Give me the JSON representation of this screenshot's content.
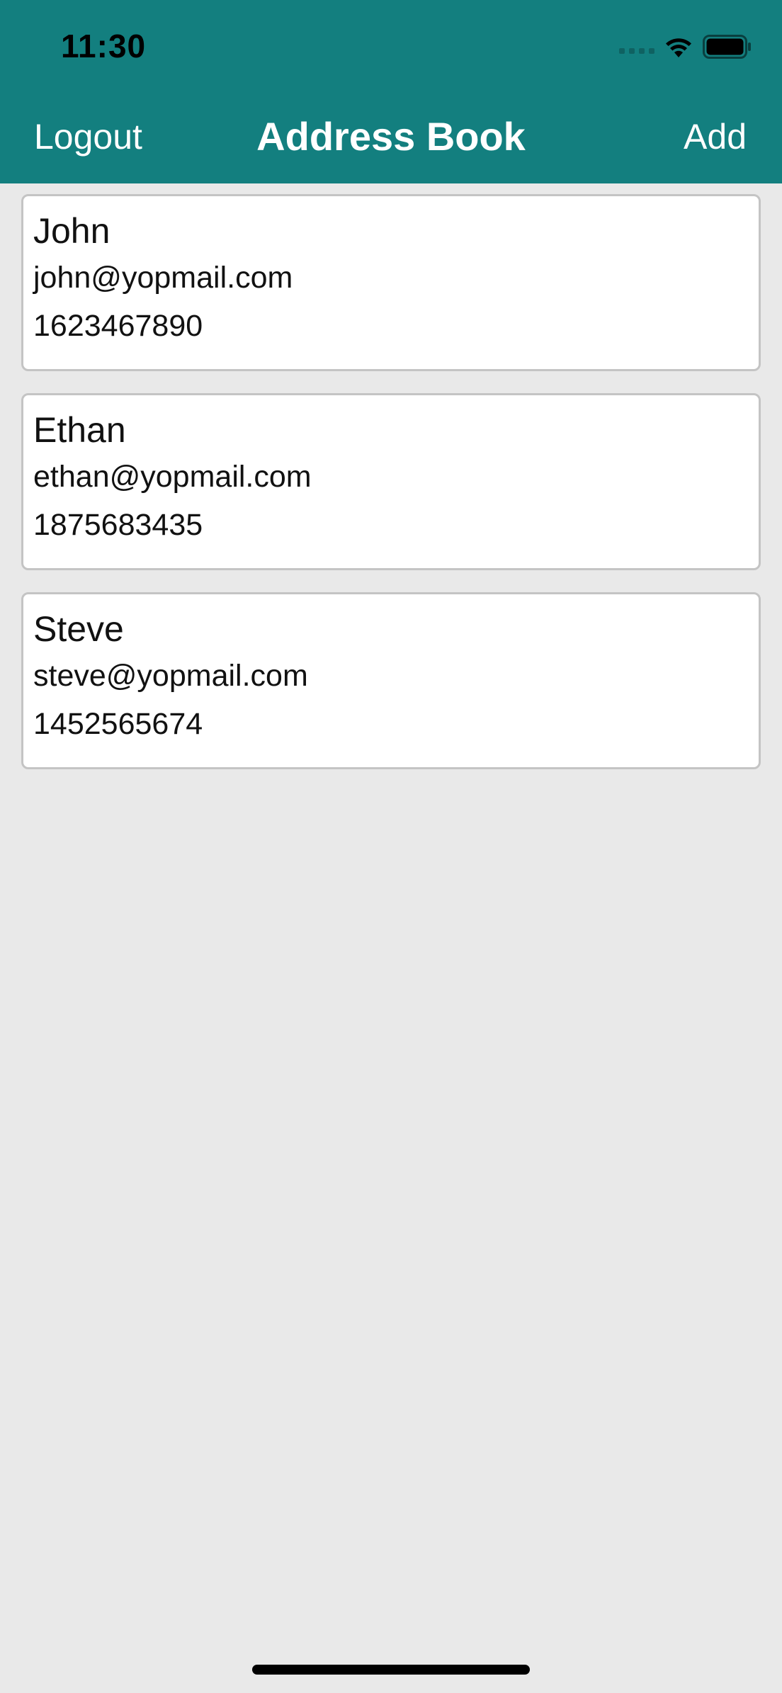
{
  "status_bar": {
    "time": "11:30"
  },
  "nav": {
    "left_label": "Logout",
    "title": "Address Book",
    "right_label": "Add"
  },
  "contacts": [
    {
      "name": "John",
      "email": "john@yopmail.com",
      "phone": "1623467890"
    },
    {
      "name": "Ethan",
      "email": "ethan@yopmail.com",
      "phone": "1875683435"
    },
    {
      "name": "Steve",
      "email": "steve@yopmail.com",
      "phone": "1452565674"
    }
  ],
  "icons": {
    "signal": "cellular-signal-icon",
    "wifi": "wifi-icon",
    "battery": "battery-icon"
  },
  "colors": {
    "header": "#137f7f",
    "background": "#e9e9e9",
    "card": "#ffffff",
    "card_border": "#c4c4c4"
  }
}
